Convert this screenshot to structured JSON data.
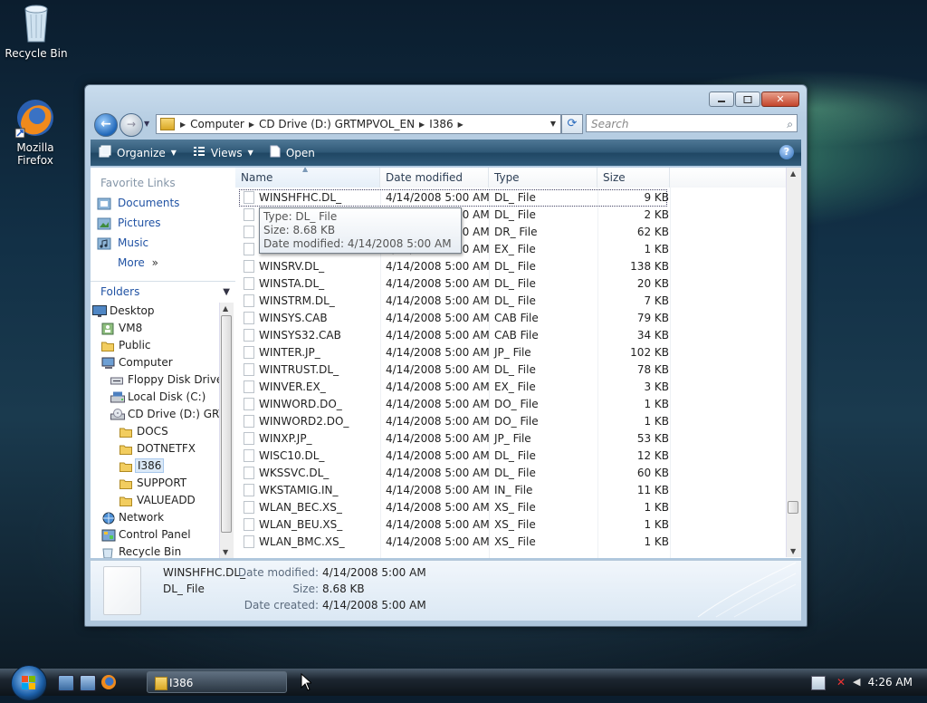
{
  "desktop": {
    "icons": [
      {
        "label": "Recycle Bin",
        "icon": "recycle-bin-icon"
      },
      {
        "label": "Mozilla Firefox",
        "icon": "firefox-icon"
      }
    ]
  },
  "window": {
    "address": {
      "crumbs": [
        "Computer",
        "CD Drive (D:) GRTMPVOL_EN",
        "I386"
      ]
    },
    "search_placeholder": "Search",
    "toolbar": {
      "organize": "Organize",
      "views": "Views",
      "open": "Open",
      "help": "?"
    },
    "nav": {
      "favorites_title": "Favorite Links",
      "favorites": [
        {
          "label": "Documents",
          "icon": "documents-icon"
        },
        {
          "label": "Pictures",
          "icon": "pictures-icon"
        },
        {
          "label": "Music",
          "icon": "music-icon"
        }
      ],
      "more": "More",
      "folders_title": "Folders",
      "tree": [
        {
          "label": "Desktop",
          "indent": 0,
          "icon": "desktop-icon"
        },
        {
          "label": "VM8",
          "indent": 1,
          "icon": "user-folder-icon"
        },
        {
          "label": "Public",
          "indent": 1,
          "icon": "folder-icon"
        },
        {
          "label": "Computer",
          "indent": 1,
          "icon": "computer-icon"
        },
        {
          "label": "Floppy Disk Drive (",
          "indent": 2,
          "icon": "floppy-icon"
        },
        {
          "label": "Local Disk (C:)",
          "indent": 2,
          "icon": "local-disk-icon"
        },
        {
          "label": "CD Drive (D:) GRTM",
          "indent": 2,
          "icon": "cd-drive-icon"
        },
        {
          "label": "DOCS",
          "indent": 3,
          "icon": "folder-icon"
        },
        {
          "label": "DOTNETFX",
          "indent": 3,
          "icon": "folder-icon"
        },
        {
          "label": "I386",
          "indent": 3,
          "icon": "folder-icon",
          "selected": true
        },
        {
          "label": "SUPPORT",
          "indent": 3,
          "icon": "folder-icon"
        },
        {
          "label": "VALUEADD",
          "indent": 3,
          "icon": "folder-icon"
        },
        {
          "label": "Network",
          "indent": 1,
          "icon": "network-icon"
        },
        {
          "label": "Control Panel",
          "indent": 1,
          "icon": "control-panel-icon"
        },
        {
          "label": "Recycle Bin",
          "indent": 1,
          "icon": "recycle-bin-icon"
        }
      ]
    },
    "columns": {
      "name": "Name",
      "date": "Date modified",
      "type": "Type",
      "size": "Size"
    },
    "files": [
      {
        "name": "WINSHFHC.DL_",
        "date": "4/14/2008 5:00 AM",
        "type": "DL_ File",
        "size": "9 KB",
        "selected": true
      },
      {
        "name": "",
        "date": "4/14/2008 5:00 AM",
        "type": "DL_ File",
        "size": "2 KB"
      },
      {
        "name": "",
        "date": "4/14/2008 5:00 AM",
        "type": "DR_ File",
        "size": "62 KB"
      },
      {
        "name": "",
        "date": "4/14/2008 5:00 AM",
        "type": "EX_ File",
        "size": "1 KB"
      },
      {
        "name": "WINSRV.DL_",
        "date": "4/14/2008 5:00 AM",
        "type": "DL_ File",
        "size": "138 KB"
      },
      {
        "name": "WINSTA.DL_",
        "date": "4/14/2008 5:00 AM",
        "type": "DL_ File",
        "size": "20 KB"
      },
      {
        "name": "WINSTRM.DL_",
        "date": "4/14/2008 5:00 AM",
        "type": "DL_ File",
        "size": "7 KB"
      },
      {
        "name": "WINSYS.CAB",
        "date": "4/14/2008 5:00 AM",
        "type": "CAB File",
        "size": "79 KB"
      },
      {
        "name": "WINSYS32.CAB",
        "date": "4/14/2008 5:00 AM",
        "type": "CAB File",
        "size": "34 KB"
      },
      {
        "name": "WINTER.JP_",
        "date": "4/14/2008 5:00 AM",
        "type": "JP_ File",
        "size": "102 KB"
      },
      {
        "name": "WINTRUST.DL_",
        "date": "4/14/2008 5:00 AM",
        "type": "DL_ File",
        "size": "78 KB"
      },
      {
        "name": "WINVER.EX_",
        "date": "4/14/2008 5:00 AM",
        "type": "EX_ File",
        "size": "3 KB"
      },
      {
        "name": "WINWORD.DO_",
        "date": "4/14/2008 5:00 AM",
        "type": "DO_ File",
        "size": "1 KB"
      },
      {
        "name": "WINWORD2.DO_",
        "date": "4/14/2008 5:00 AM",
        "type": "DO_ File",
        "size": "1 KB"
      },
      {
        "name": "WINXP.JP_",
        "date": "4/14/2008 5:00 AM",
        "type": "JP_ File",
        "size": "53 KB"
      },
      {
        "name": "WISC10.DL_",
        "date": "4/14/2008 5:00 AM",
        "type": "DL_ File",
        "size": "12 KB"
      },
      {
        "name": "WKSSVC.DL_",
        "date": "4/14/2008 5:00 AM",
        "type": "DL_ File",
        "size": "60 KB"
      },
      {
        "name": "WKSTAMIG.IN_",
        "date": "4/14/2008 5:00 AM",
        "type": "IN_ File",
        "size": "11 KB"
      },
      {
        "name": "WLAN_BEC.XS_",
        "date": "4/14/2008 5:00 AM",
        "type": "XS_ File",
        "size": "1 KB"
      },
      {
        "name": "WLAN_BEU.XS_",
        "date": "4/14/2008 5:00 AM",
        "type": "XS_ File",
        "size": "1 KB"
      },
      {
        "name": "WLAN_BMC.XS_",
        "date": "4/14/2008 5:00 AM",
        "type": "XS_ File",
        "size": "1 KB"
      }
    ],
    "tooltip": {
      "type_line": "Type: DL_ File",
      "size_line": "Size: 8.68 KB",
      "date_line": "Date modified: 4/14/2008 5:00 AM"
    },
    "details": {
      "name": "WINSHFHC.DL_",
      "type": "DL_ File",
      "date_modified_label": "Date modified:",
      "date_modified": "4/14/2008 5:00 AM",
      "size_label": "Size:",
      "size": "8.68 KB",
      "date_created_label": "Date created:",
      "date_created": "4/14/2008 5:00 AM"
    }
  },
  "taskbar": {
    "task_label": "I386",
    "clock": "4:26 AM"
  }
}
